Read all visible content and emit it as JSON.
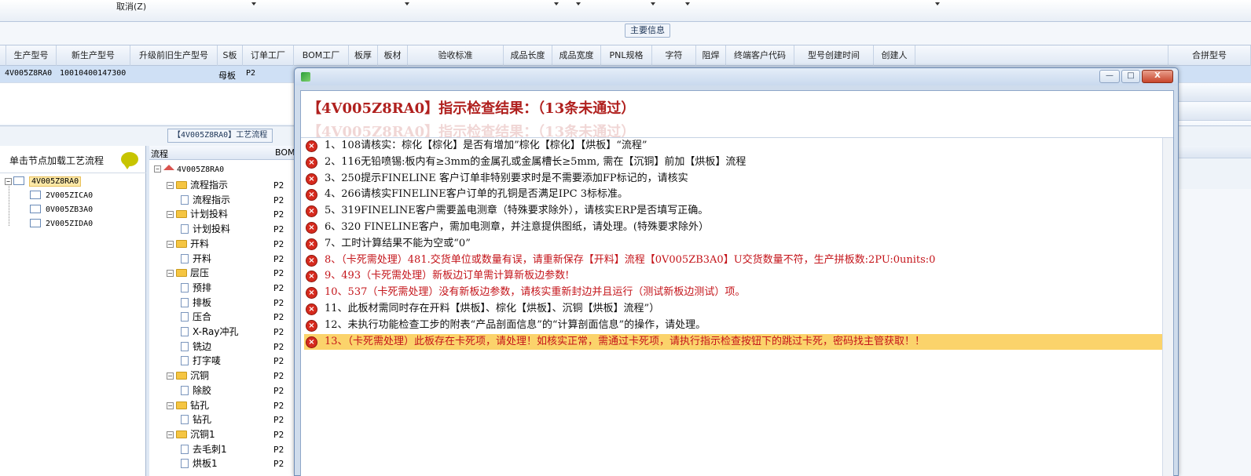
{
  "toolbar": {
    "cancel_label": "取消(Z)"
  },
  "main_info": {
    "group_title": "主要信息",
    "columns": [
      "生产型号",
      "新生产型号",
      "升级前旧生产型号",
      "S板",
      "订单工厂",
      "BOM工厂",
      "板厚",
      "板材",
      "验收标准",
      "成品长度",
      "成品宽度",
      "PNL规格",
      "字符",
      "阻焊",
      "终端客户代码",
      "型号创建时间",
      "创建人"
    ],
    "right_column": "合拼型号",
    "row": {
      "production_model": "4V005Z8RA0",
      "new_model": "10010400147300",
      "s_board": "母板",
      "order_factory": "P2"
    }
  },
  "process": {
    "title": "【4V005Z8RA0】工艺流程",
    "left_hint": "单击节点加载工艺流程",
    "left_tree": [
      {
        "label": "4V005Z8RA0",
        "selected": true
      },
      {
        "label": "2V005ZICA0",
        "selected": false
      },
      {
        "label": "0V005ZB3A0",
        "selected": false
      },
      {
        "label": "2V005ZIDA0",
        "selected": false
      }
    ],
    "mid_header": {
      "col1": "流程",
      "col2": "BOM"
    },
    "mid_root": "4V005Z8RA0",
    "mid_tree": [
      {
        "label": "流程指示",
        "type": "folder",
        "code": "P2"
      },
      {
        "label": "流程指示",
        "type": "leaf",
        "code": "P2"
      },
      {
        "label": "计划投料",
        "type": "folder",
        "code": "P2"
      },
      {
        "label": "计划投料",
        "type": "leaf",
        "code": "P2"
      },
      {
        "label": "开料",
        "type": "folder",
        "code": "P2"
      },
      {
        "label": "开料",
        "type": "leaf",
        "code": "P2"
      },
      {
        "label": "层压",
        "type": "folder",
        "code": "P2"
      },
      {
        "label": "预排",
        "type": "leaf",
        "code": "P2"
      },
      {
        "label": "排板",
        "type": "leaf",
        "code": "P2"
      },
      {
        "label": "压合",
        "type": "leaf",
        "code": "P2"
      },
      {
        "label": "X-Ray冲孔",
        "type": "leaf",
        "code": "P2"
      },
      {
        "label": "铣边",
        "type": "leaf",
        "code": "P2"
      },
      {
        "label": "打字唛",
        "type": "leaf",
        "code": "P2"
      },
      {
        "label": "沉铜",
        "type": "folder",
        "code": "P2"
      },
      {
        "label": "除胶",
        "type": "leaf",
        "code": "P2"
      },
      {
        "label": "钻孔",
        "type": "folder",
        "code": "P2"
      },
      {
        "label": "钻孔",
        "type": "leaf",
        "code": "P2"
      },
      {
        "label": "沉铜1",
        "type": "folder",
        "code": "P2"
      },
      {
        "label": "去毛刺1",
        "type": "leaf",
        "code": "P2"
      },
      {
        "label": "烘板1",
        "type": "leaf",
        "code": "P2"
      }
    ]
  },
  "dialog": {
    "headline": "【4V005Z8RA0】指示检查结果：（13条未通过）",
    "ghost_headline": "【4V005Z8RA0】指示检查结果：（13条未通过）",
    "window_buttons": {
      "minimize": "—",
      "maximize": "□",
      "close": "X"
    },
    "messages": [
      {
        "text": "1、108请核实：棕化【棕化】是否有增加”棕化【棕化】【烘板】“流程”",
        "color": "black"
      },
      {
        "text": "2、116无铅喷锡:板内有≥3mm的金属孔或金属槽长≥5mm, 需在【沉铜】前加【烘板】流程",
        "color": "black"
      },
      {
        "text": "3、250提示FINELINE 客户订单非特别要求时是不需要添加FP标记的，请核实",
        "color": "black"
      },
      {
        "text": "4、266请核实FINELINE客户订单的孔铜是否满足IPC 3标标准。",
        "color": "black"
      },
      {
        "text": "5、319FINELINE客户需要盖电测章（特殊要求除外），请核实ERP是否填写正确。",
        "color": "black"
      },
      {
        "text": "6、320 FINELINE客户，需加电测章，并注意提供图纸，请处理。(特殊要求除外）",
        "color": "black"
      },
      {
        "text": "7、工时计算结果不能为空或“0”",
        "color": "black"
      },
      {
        "text": "8、（卡死需处理）481.交货单位或数量有误，请重新保存【开料】流程【0V005ZB3A0】U交货数量不符，生产拼板数:2PU:0units:0",
        "color": "red"
      },
      {
        "text": "9、493（卡死需处理）新板边订单需计算新板边参数!",
        "color": "red"
      },
      {
        "text": "10、537（卡死需处理）没有新板边参数，请核实重新封边并且运行（测试新板边测试）项。",
        "color": "red"
      },
      {
        "text": "11、此板材需同时存在开料【烘板】、棕化【烘板】、沉铜【烘板】流程”）",
        "color": "black"
      },
      {
        "text": "12、未执行功能检查工步的附表“产品剖面信息”的“计算剖面信息”的操作，请处理。",
        "color": "black"
      },
      {
        "text": "13、（卡死需处理）此板存在卡死项，请处理！如核实正常，需通过卡死项，请执行指示检查按钮下的跳过卡死，密码找主管获取！！",
        "color": "red",
        "highlight": true
      }
    ]
  },
  "colors": {
    "error_red": "#c4141a",
    "highlight": "#fbd36b",
    "headline_red": "#b0201e"
  }
}
